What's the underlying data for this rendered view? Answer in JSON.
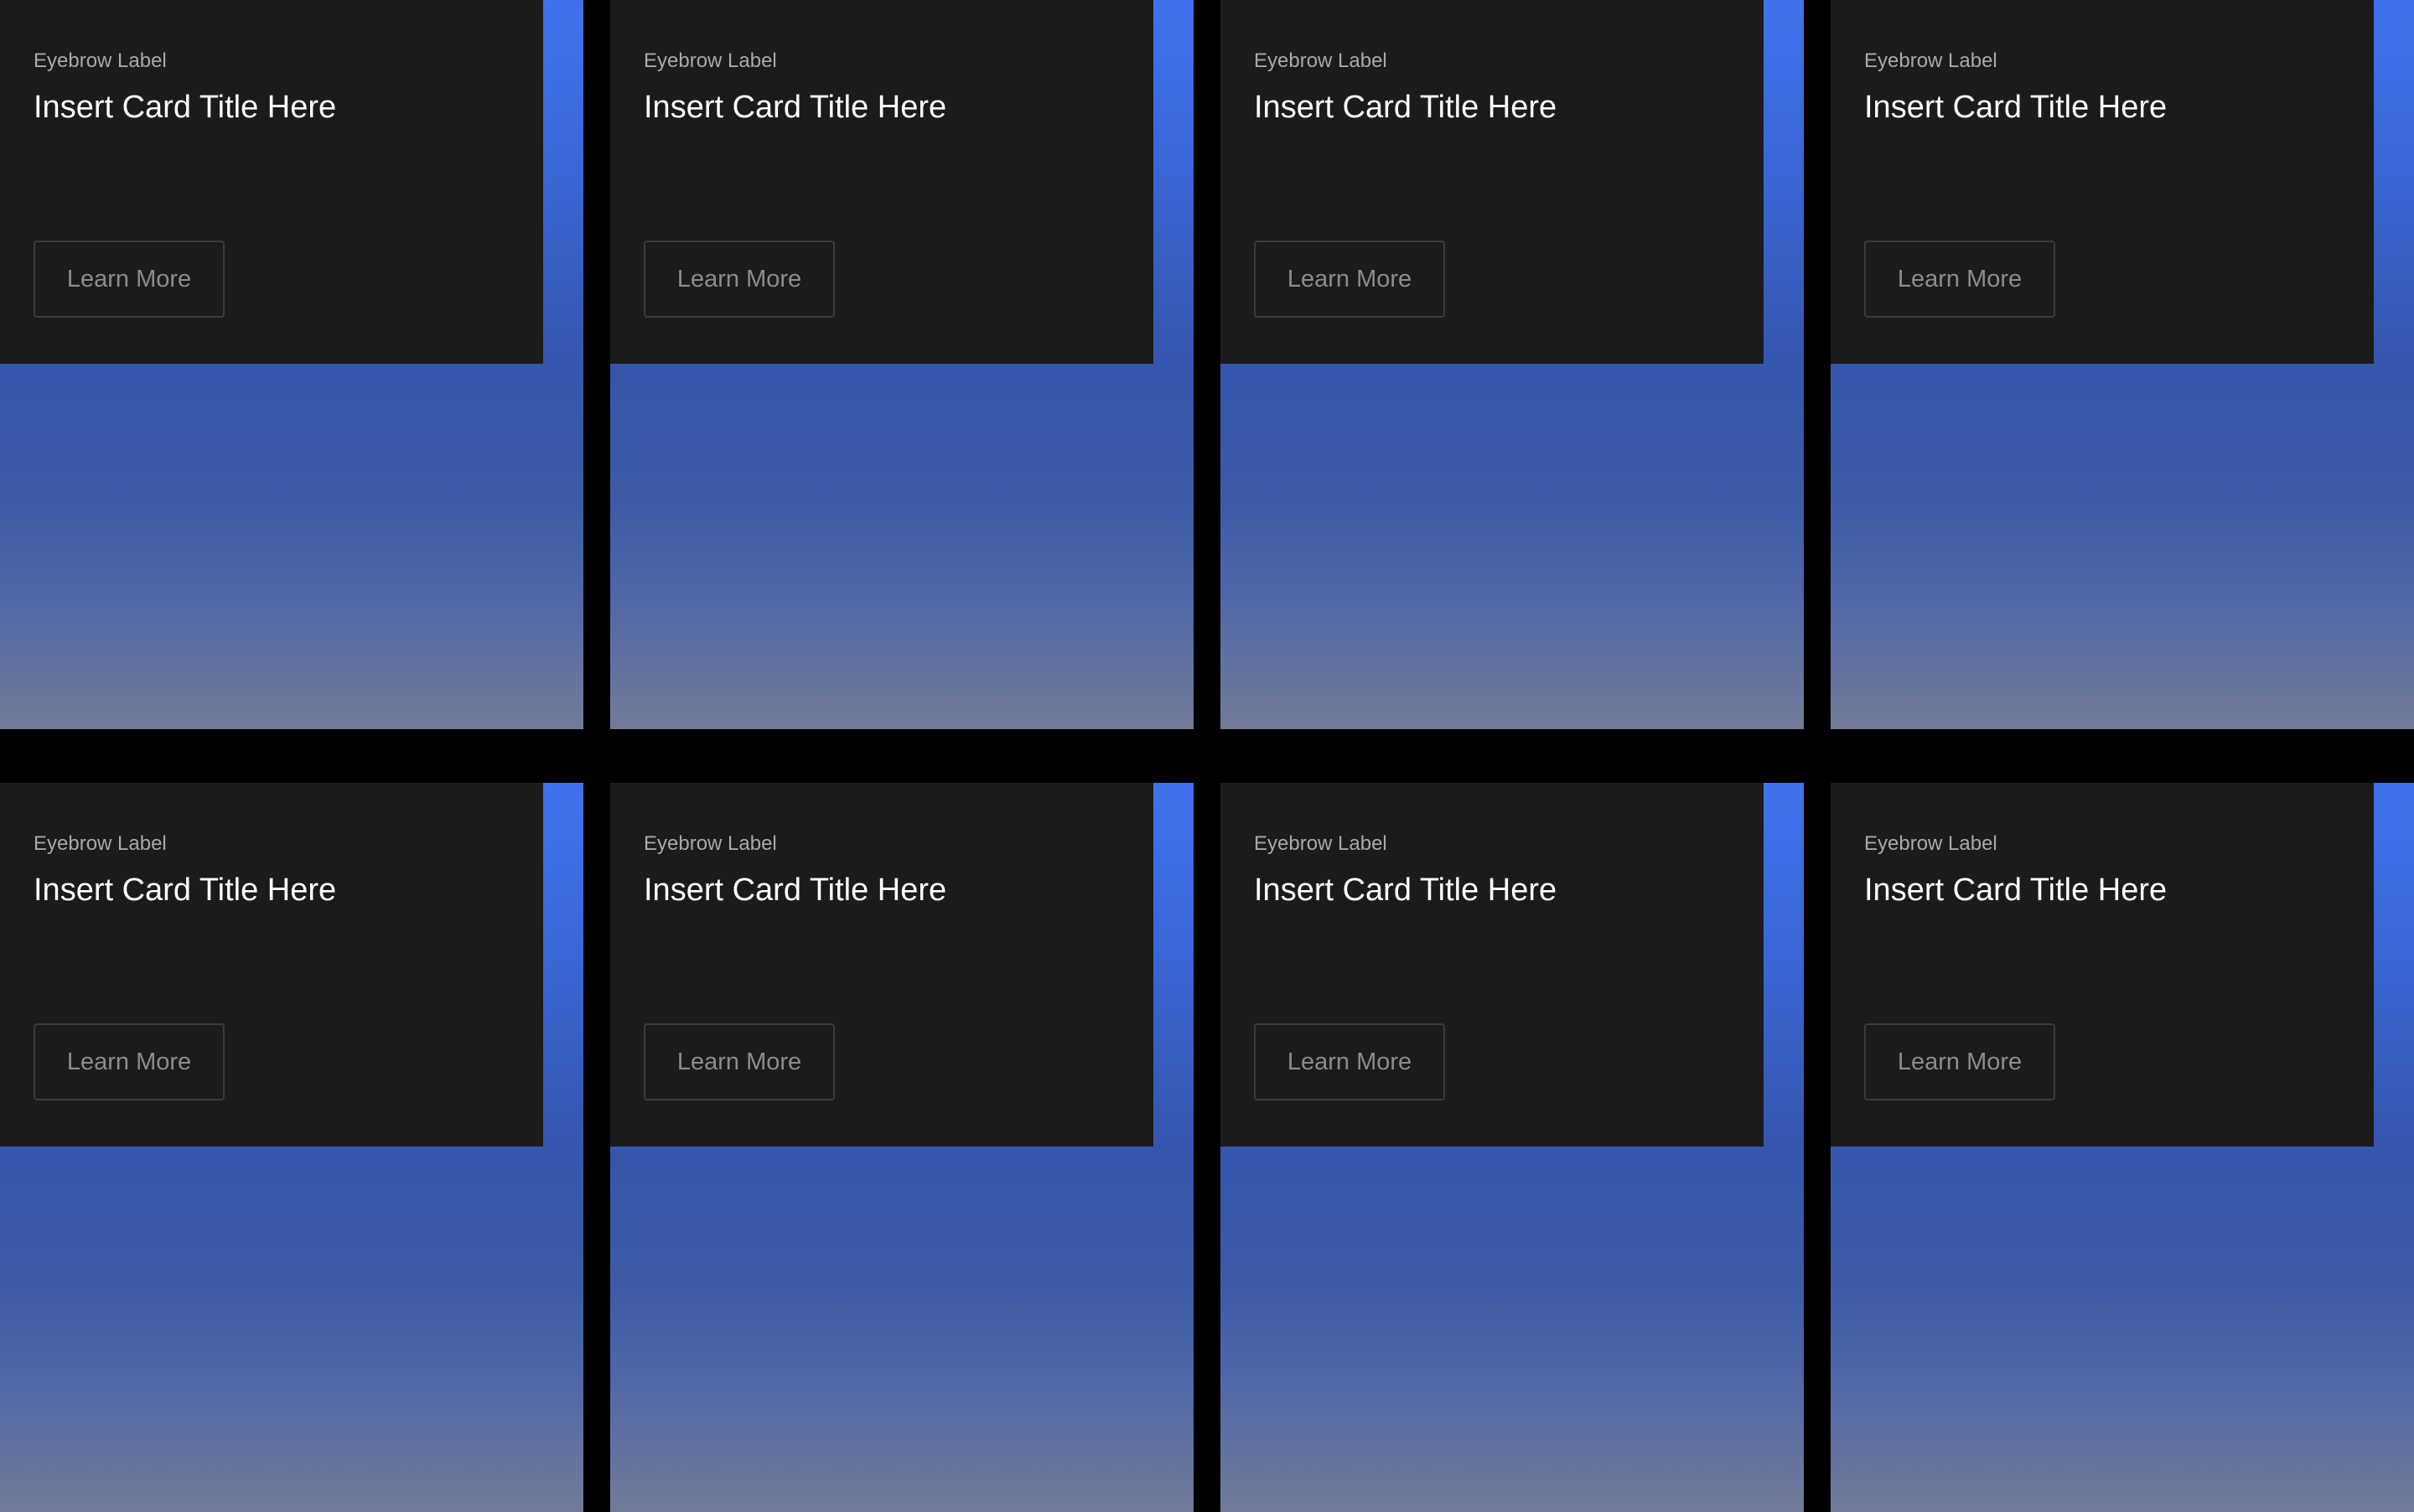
{
  "cards": [
    {
      "eyebrow": "Eyebrow Label",
      "title": "Insert Card Title Here",
      "button_label": "Learn More"
    },
    {
      "eyebrow": "Eyebrow Label",
      "title": "Insert Card Title Here",
      "button_label": "Learn More"
    },
    {
      "eyebrow": "Eyebrow Label",
      "title": "Insert Card Title Here",
      "button_label": "Learn More"
    },
    {
      "eyebrow": "Eyebrow Label",
      "title": "Insert Card Title Here",
      "button_label": "Learn More"
    },
    {
      "eyebrow": "Eyebrow Label",
      "title": "Insert Card Title Here",
      "button_label": "Learn More"
    },
    {
      "eyebrow": "Eyebrow Label",
      "title": "Insert Card Title Here",
      "button_label": "Learn More"
    },
    {
      "eyebrow": "Eyebrow Label",
      "title": "Insert Card Title Here",
      "button_label": "Learn More"
    },
    {
      "eyebrow": "Eyebrow Label",
      "title": "Insert Card Title Here",
      "button_label": "Learn More"
    }
  ],
  "colors": {
    "page_background": "#000000",
    "panel_background": "#1b1b1b",
    "gradient_top": "#3f72ec",
    "gradient_bottom": "#737b98",
    "title_text": "#ffffff",
    "eyebrow_text": "#a9a9a9",
    "button_text": "#8c8c8c",
    "button_border": "#3b3b3b"
  }
}
